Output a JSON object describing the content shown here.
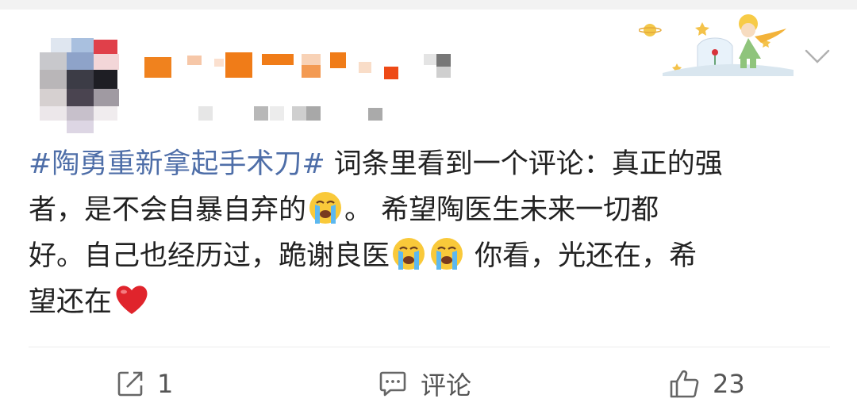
{
  "post": {
    "hashtag": "#陶勇重新拿起手术刀#",
    "line1_text": " 词条里看到一个评论：真正的强",
    "line2_text": "者，是不会自暴自弃的",
    "line2_after": "。  希望陶医生未来一切都",
    "line3_text": "好。自己也经历过，跪谢良医",
    "line3_after": " 你看，光还在，希",
    "line4_text": "望还在"
  },
  "actions": {
    "repost_count": "1",
    "comment_label": "评论",
    "like_count": "23"
  },
  "icons": {
    "repost": "share-icon",
    "comment": "comment-icon",
    "like": "thumbs-up-icon",
    "crying": "loudly-crying-face-icon",
    "heart": "red-heart-icon",
    "more": "chevron-down-icon"
  },
  "colors": {
    "hashtag": "#4e6ea8",
    "text": "#222222",
    "action": "#555555",
    "heart": "#e0242c"
  }
}
